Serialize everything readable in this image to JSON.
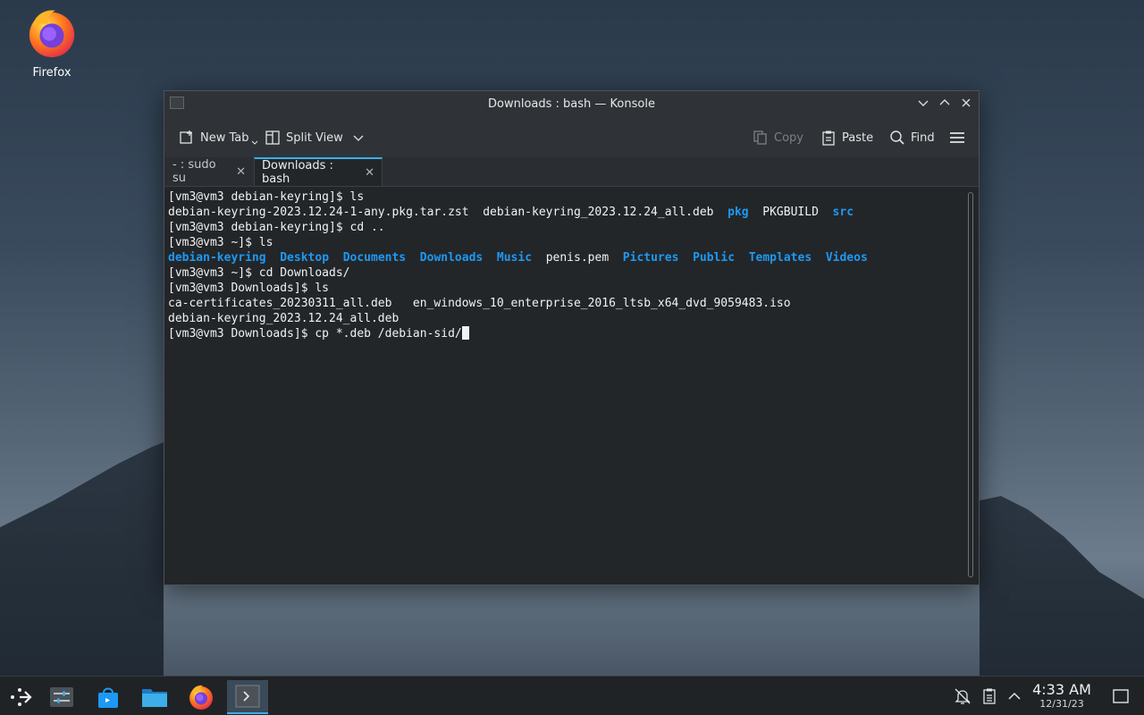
{
  "desktop": {
    "icons": [
      {
        "label": "Firefox",
        "icon": "firefox-icon"
      }
    ]
  },
  "window": {
    "title": "Downloads : bash — Konsole",
    "toolbar": {
      "new_tab": "New Tab",
      "split_view": "Split View",
      "copy": "Copy",
      "paste": "Paste",
      "find": "Find"
    },
    "tabs": [
      {
        "label": "- : sudo su",
        "active": false
      },
      {
        "label": "Downloads : bash",
        "active": true
      }
    ],
    "terminal": {
      "lines": [
        [
          {
            "t": "[vm3@vm3 debian-keyring]$ ls"
          }
        ],
        [
          {
            "t": "debian-keyring-2023.12.24-1-any.pkg.tar.zst  debian-keyring_2023.12.24_all.deb  "
          },
          {
            "t": "pkg",
            "dir": true
          },
          {
            "t": "  PKGBUILD  "
          },
          {
            "t": "src",
            "dir": true
          }
        ],
        [
          {
            "t": "[vm3@vm3 debian-keyring]$ cd .."
          }
        ],
        [
          {
            "t": "[vm3@vm3 ~]$ ls"
          }
        ],
        [
          {
            "t": "debian-keyring",
            "dir": true
          },
          {
            "t": "  "
          },
          {
            "t": "Desktop",
            "dir": true
          },
          {
            "t": "  "
          },
          {
            "t": "Documents",
            "dir": true
          },
          {
            "t": "  "
          },
          {
            "t": "Downloads",
            "dir": true
          },
          {
            "t": "  "
          },
          {
            "t": "Music",
            "dir": true
          },
          {
            "t": "  penis.pem  "
          },
          {
            "t": "Pictures",
            "dir": true
          },
          {
            "t": "  "
          },
          {
            "t": "Public",
            "dir": true
          },
          {
            "t": "  "
          },
          {
            "t": "Templates",
            "dir": true
          },
          {
            "t": "  "
          },
          {
            "t": "Videos",
            "dir": true
          }
        ],
        [
          {
            "t": "[vm3@vm3 ~]$ cd Downloads/"
          }
        ],
        [
          {
            "t": "[vm3@vm3 Downloads]$ ls"
          }
        ],
        [
          {
            "t": "ca-certificates_20230311_all.deb   en_windows_10_enterprise_2016_ltsb_x64_dvd_9059483.iso"
          }
        ],
        [
          {
            "t": "debian-keyring_2023.12.24_all.deb"
          }
        ],
        [
          {
            "t": "[vm3@vm3 Downloads]$ cp *.deb /debian-sid/"
          }
        ]
      ],
      "dir_color": "#1d99f3"
    }
  },
  "taskbar": {
    "items": [
      {
        "name": "application-launcher",
        "icon": "kde-launcher-icon"
      },
      {
        "name": "system-settings",
        "icon": "settings-sliders-icon"
      },
      {
        "name": "discover",
        "icon": "store-bag-icon"
      },
      {
        "name": "dolphin",
        "icon": "folder-icon"
      },
      {
        "name": "firefox",
        "icon": "firefox-icon"
      },
      {
        "name": "konsole",
        "icon": "terminal-icon",
        "active": true
      }
    ],
    "clock": {
      "time": "4:33 AM",
      "date": "12/31/23"
    }
  },
  "colors": {
    "accent": "#3daee9",
    "terminal_bg": "#232629"
  }
}
